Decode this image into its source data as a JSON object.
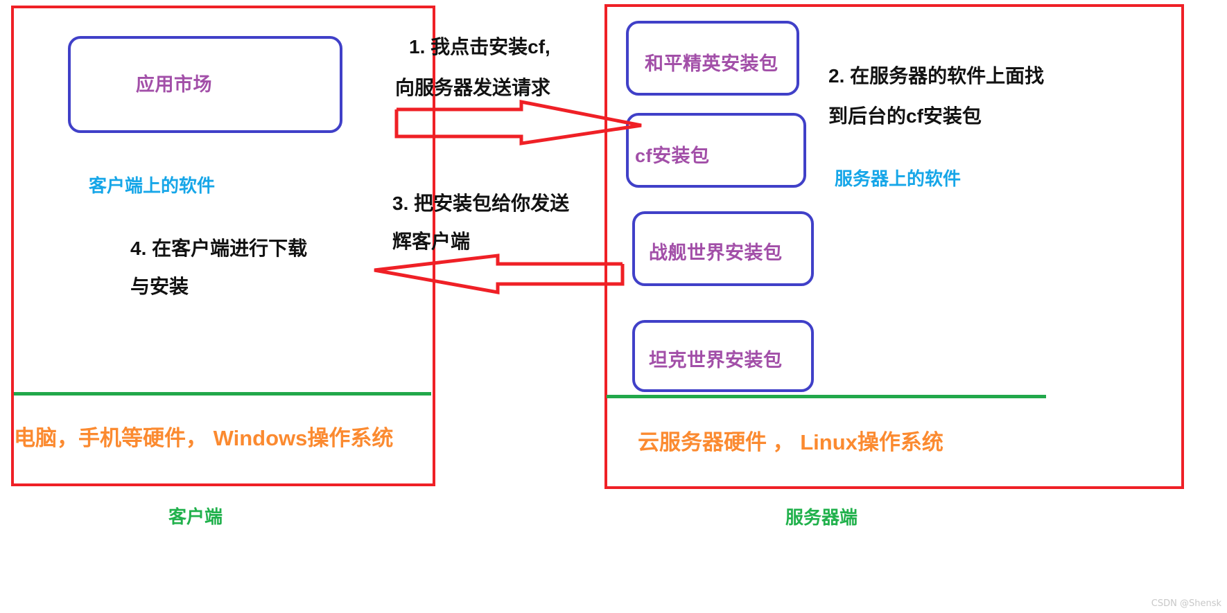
{
  "diagram": {
    "client": {
      "app_store_box_label": "应用市场",
      "software_label": "客户端上的软件",
      "hardware_label": "电脑，手机等硬件， Windows操作系统",
      "tier_label": "客户端",
      "step4_line1": "4. 在客户端进行下载",
      "step4_line2": "与安装"
    },
    "server": {
      "packages": [
        {
          "label": "和平精英安装包"
        },
        {
          "label": "cf安装包"
        },
        {
          "label": "战舰世界安装包"
        },
        {
          "label": "坦克世界安装包"
        }
      ],
      "software_label": "服务器上的软件",
      "hardware_label": "云服务器硬件 ， Linux操作系统",
      "tier_label": "服务器端",
      "step2_line1": "2. 在服务器的软件上面找",
      "step2_line2": "到后台的cf安装包"
    },
    "flows": {
      "step1_line1": "1. 我点击安装cf,",
      "step1_line2": "向服务器发送请求",
      "step3_line1": "3. 把安装包给你发送",
      "step3_line2": "辉客户端"
    },
    "watermark": "CSDN @Shensk",
    "colors": {
      "panel_border": "#ef2026",
      "package_border": "#4040c8",
      "package_text": "#a24fa8",
      "software_text": "#16a6e8",
      "hardware_text": "#fb8a30",
      "tier_text": "#21b14c",
      "base_line": "#21a84a",
      "arrow": "#ef2026"
    }
  }
}
